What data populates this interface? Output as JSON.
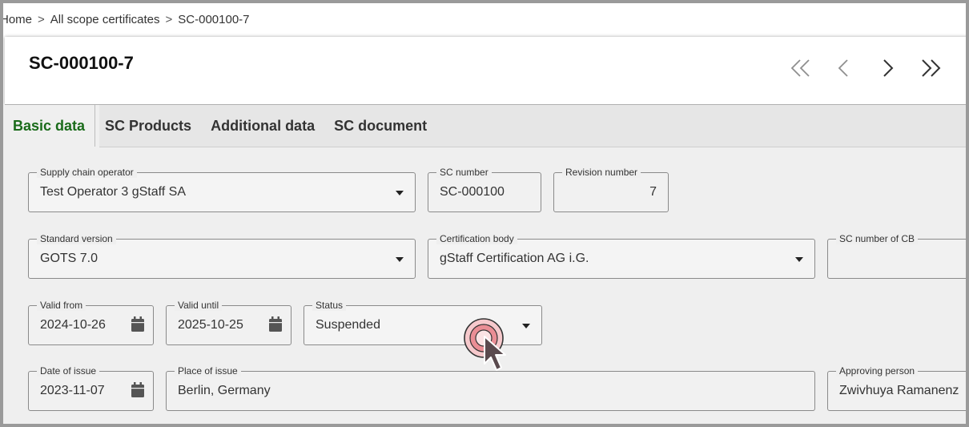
{
  "breadcrumb": {
    "items": [
      "Home",
      "All scope certificates",
      "SC-000100-7"
    ],
    "separator": ">"
  },
  "header": {
    "title": "SC-000100-7",
    "pager": {
      "first": "«",
      "prev": "‹",
      "next": "›",
      "last": "»"
    }
  },
  "tabs": [
    {
      "label": "Basic data",
      "active": true
    },
    {
      "label": "SC Products",
      "active": false
    },
    {
      "label": "Additional data",
      "active": false
    },
    {
      "label": "SC document",
      "active": false
    }
  ],
  "form": {
    "supply_chain_operator": {
      "label": "Supply chain operator",
      "value": "Test Operator 3 gStaff SA"
    },
    "sc_number": {
      "label": "SC number",
      "value": "SC-000100"
    },
    "revision_number": {
      "label": "Revision number",
      "value": "7"
    },
    "standard_version": {
      "label": "Standard version",
      "value": "GOTS 7.0"
    },
    "certification_body": {
      "label": "Certification body",
      "value": "gStaff Certification AG i.G."
    },
    "sc_number_of_cb": {
      "label": "SC number of CB",
      "value": ""
    },
    "valid_from": {
      "label": "Valid from",
      "value": "2024-10-26"
    },
    "valid_until": {
      "label": "Valid until",
      "value": "2025-10-25"
    },
    "status": {
      "label": "Status",
      "value": "Suspended"
    },
    "date_of_issue": {
      "label": "Date of issue",
      "value": "2023-11-07"
    },
    "place_of_issue": {
      "label": "Place of issue",
      "value": "Berlin, Germany"
    },
    "approving_person": {
      "label": "Approving person",
      "value": "Zwivhuya Ramanenz"
    }
  },
  "colors": {
    "active_tab": "#1a6b1a",
    "form_background": "#efefef",
    "field_border": "#8a8a8a",
    "click_indicator": "#d9636b"
  },
  "icons": {
    "calendar": "calendar-icon",
    "dropdown": "chevron-down-icon",
    "cursor": "mouse-pointer-icon"
  }
}
